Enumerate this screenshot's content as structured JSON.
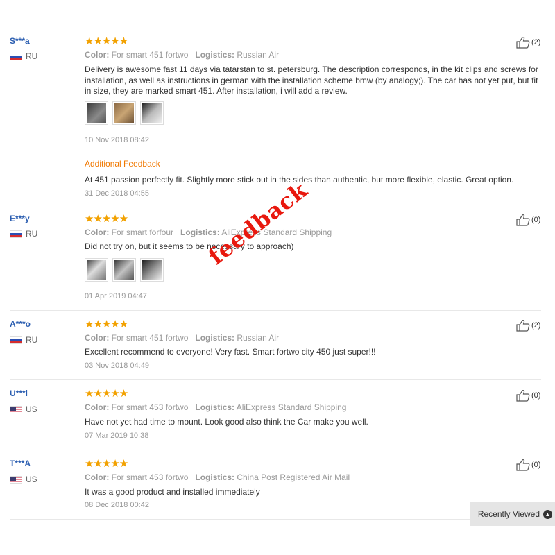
{
  "reviews": [
    {
      "user": "S***a",
      "country": "RU",
      "rating": "★★★★★",
      "color_label": "Color:",
      "color": "For smart 451 fortwo",
      "logistics_label": "Logistics:",
      "logistics": "Russian Air",
      "text": "Delivery is awesome fast 11 days via tatarstan to st. petersburg. The description corresponds, in the kit clips and screws for installation, as well as instructions in german with the installation scheme bmw (by analogy;). The car has not yet put, but fit in size, they are marked smart 451. After installation, i will add a review.",
      "date": "10 Nov 2018 08:42",
      "helpful": "(2)",
      "additional": {
        "label": "Additional Feedback",
        "text": "At 451 passion perfectly fit. Slightly more stick out in the sides than authentic, but more flexible, elastic. Great option.",
        "date": "31 Dec 2018 04:55"
      }
    },
    {
      "user": "E***y",
      "country": "RU",
      "rating": "★★★★★",
      "color_label": "Color:",
      "color": "For smart forfour",
      "logistics_label": "Logistics:",
      "logistics": "AliExpress Standard Shipping",
      "text": "Did not try on, but it seems to be necessary to approach)",
      "date": "01 Apr 2019 04:47",
      "helpful": "(0)"
    },
    {
      "user": "A***o",
      "country": "RU",
      "rating": "★★★★★",
      "color_label": "Color:",
      "color": "For smart 451 fortwo",
      "logistics_label": "Logistics:",
      "logistics": "Russian Air",
      "text": "Excellent recommend to everyone! Very fast. Smart fortwo city 450 just super!!!",
      "date": "03 Nov 2018 04:49",
      "helpful": "(2)"
    },
    {
      "user": "U***l",
      "country": "US",
      "rating": "★★★★★",
      "color_label": "Color:",
      "color": "For smart 453 fortwo",
      "logistics_label": "Logistics:",
      "logistics": "AliExpress Standard Shipping",
      "text": "Have not yet had time to mount. Look good also think the Car make you well.",
      "date": "07 Mar 2019 10:38",
      "helpful": "(0)"
    },
    {
      "user": "T***A",
      "country": "US",
      "rating": "★★★★★",
      "color_label": "Color:",
      "color": "For smart 453 fortwo",
      "logistics_label": "Logistics:",
      "logistics": "China Post Registered Air Mail",
      "text": "It was a good product and installed immediately",
      "date": "08 Dec 2018 00:42",
      "helpful": "(0)"
    }
  ],
  "watermark": "feedback",
  "recently_viewed": "Recently Viewed",
  "colors": {
    "username": "#2a5db0",
    "stars": "#f2a100",
    "additional_feedback": "#f07800",
    "watermark": "#e8180e"
  }
}
